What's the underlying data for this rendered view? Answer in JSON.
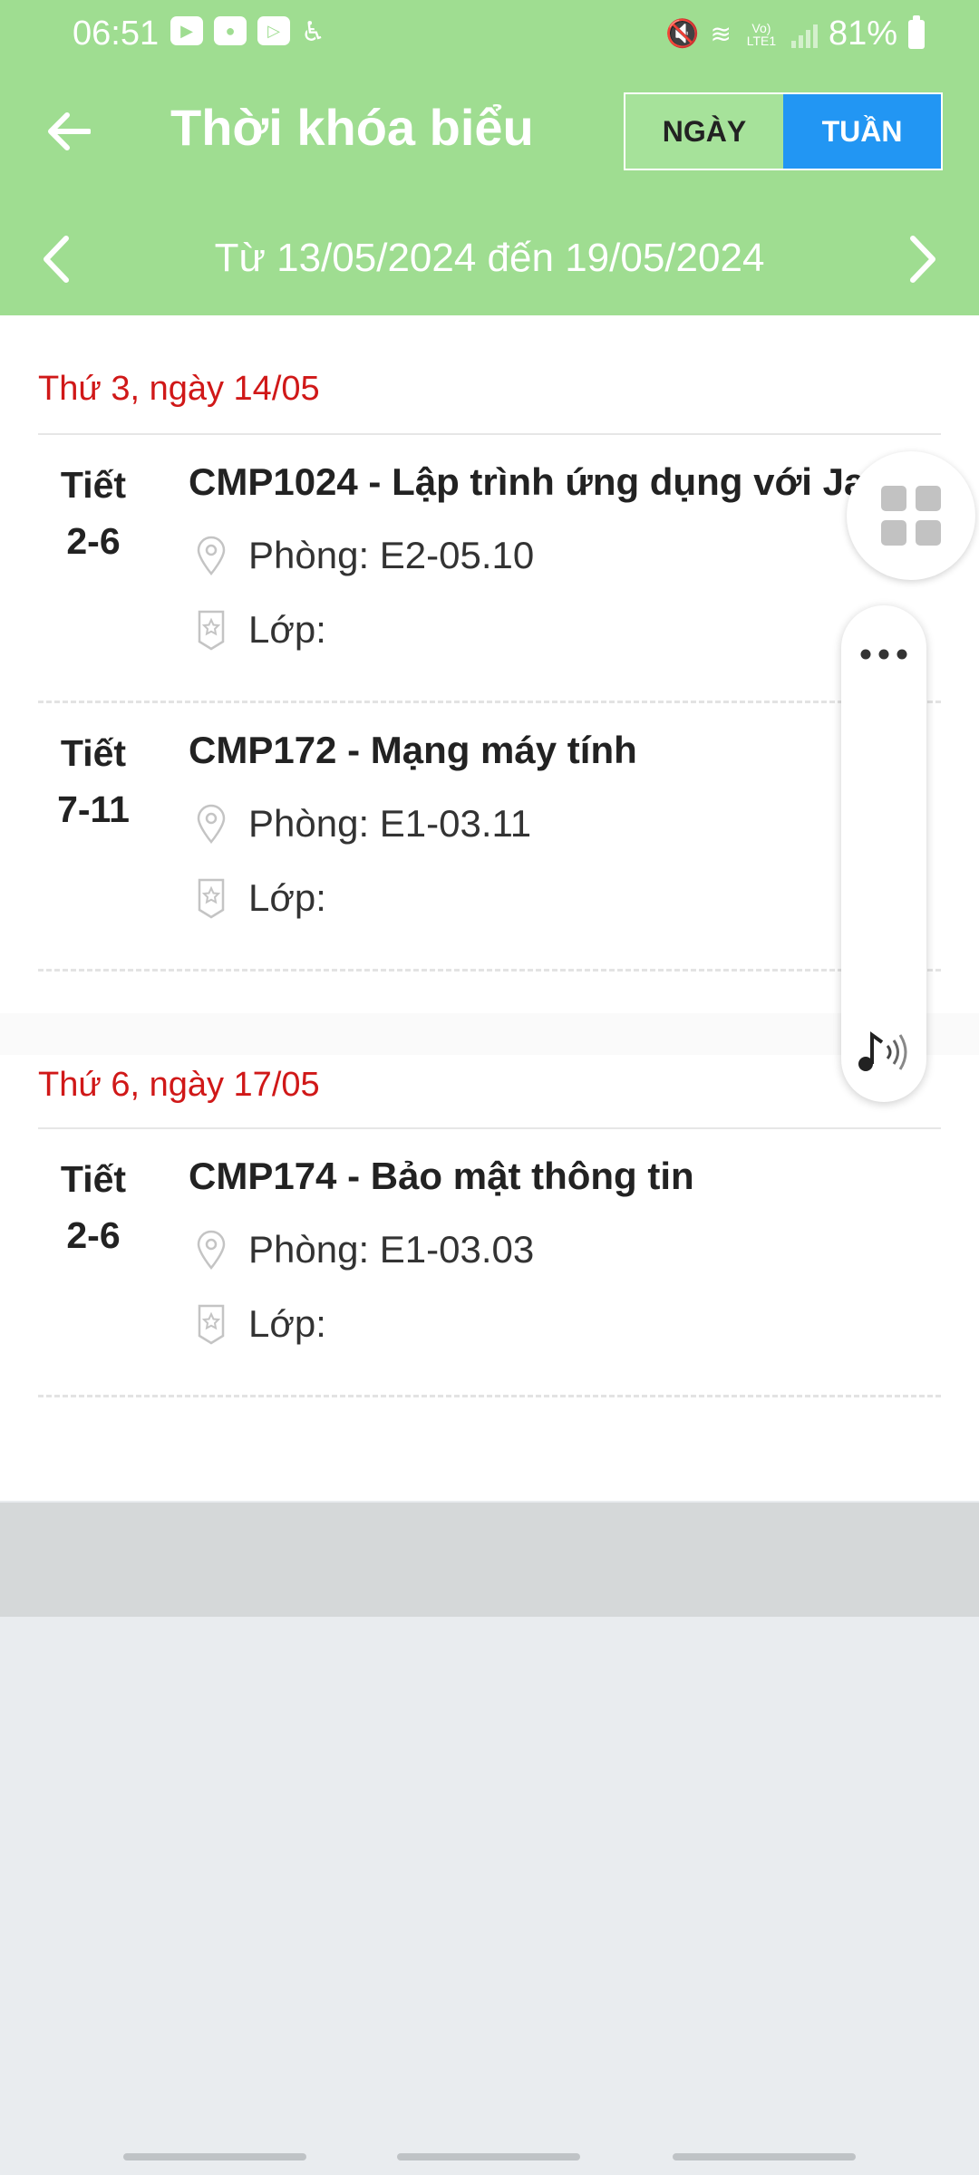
{
  "status_bar": {
    "time": "06:51",
    "battery": "81%",
    "network_label": "Vo) LTE1"
  },
  "header": {
    "title": "Thời khóa biểu",
    "view_day": "NGÀY",
    "view_week": "TUẦN",
    "selected_view": "TUẦN",
    "date_range": "Từ 13/05/2024 đến 19/05/2024"
  },
  "days": [
    {
      "header": "Thứ 3, ngày 14/05",
      "lessons": [
        {
          "period_label": "Tiết",
          "period_range": "2-6",
          "title": "CMP1024 - Lập trình ứng dụng với Java",
          "room": "Phòng: E2-05.10",
          "class": "Lớp:"
        },
        {
          "period_label": "Tiết",
          "period_range": "7-11",
          "title": "CMP172 - Mạng máy tính",
          "room": "Phòng: E1-03.11",
          "class": "Lớp:"
        }
      ]
    },
    {
      "header": "Thứ 6, ngày 17/05",
      "lessons": [
        {
          "period_label": "Tiết",
          "period_range": "2-6",
          "title": "CMP174 - Bảo mật thông tin",
          "room": "Phòng: E1-03.03",
          "class": "Lớp:"
        }
      ]
    }
  ],
  "colors": {
    "header_bg": "#9fdd91",
    "active_toggle": "#2296f3",
    "day_header": "#d01818"
  }
}
